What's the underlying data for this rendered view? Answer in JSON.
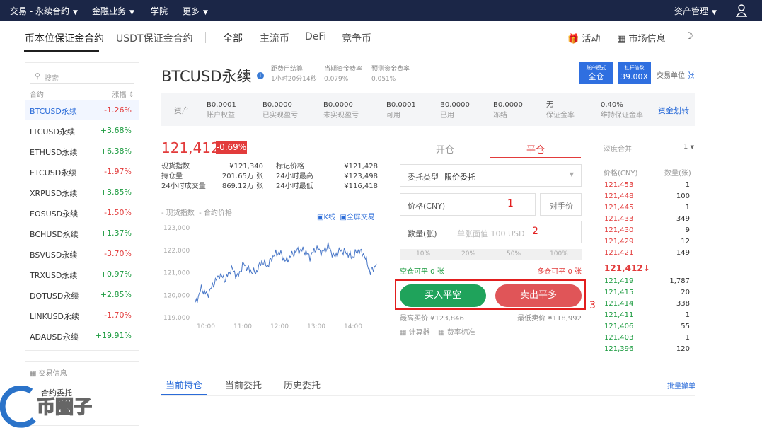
{
  "topnav": {
    "trade": "交易 - 永续合约",
    "finance": "金融业务",
    "academy": "学院",
    "more": "更多",
    "assets": "资产管理"
  },
  "subnav": {
    "coin_margined": "币本位保证金合约",
    "usdt_margined": "USDT保证金合约",
    "cat_all": "全部",
    "cat_main": "主流币",
    "cat_defi": "DeFi",
    "cat_compete": "竞争币",
    "activity": "活动",
    "market_info": "市场信息"
  },
  "sidebar": {
    "search_placeholder": "搜索",
    "col_contract": "合约",
    "col_change": "涨幅",
    "items": [
      {
        "name": "BTCUSD永续",
        "change": "-1.26%",
        "dir": "down"
      },
      {
        "name": "LTCUSD永续",
        "change": "+3.68%",
        "dir": "up"
      },
      {
        "name": "ETHUSD永续",
        "change": "+6.38%",
        "dir": "up"
      },
      {
        "name": "ETCUSD永续",
        "change": "-1.97%",
        "dir": "down"
      },
      {
        "name": "XRPUSD永续",
        "change": "+3.85%",
        "dir": "up"
      },
      {
        "name": "EOSUSD永续",
        "change": "-1.50%",
        "dir": "down"
      },
      {
        "name": "BCHUSD永续",
        "change": "+1.37%",
        "dir": "up"
      },
      {
        "name": "BSVUSD永续",
        "change": "-3.70%",
        "dir": "down"
      },
      {
        "name": "TRXUSD永续",
        "change": "+0.97%",
        "dir": "up"
      },
      {
        "name": "DOTUSD永续",
        "change": "+2.85%",
        "dir": "up"
      },
      {
        "name": "LINKUSD永续",
        "change": "-1.70%",
        "dir": "down"
      },
      {
        "name": "ADAUSD永续",
        "change": "+19.91%",
        "dir": "up"
      }
    ],
    "info_title": "交易信息",
    "info_item": "合约委托"
  },
  "header": {
    "title": "BTCUSD永续",
    "funding_label": "距费用结算",
    "funding_value": "1小时20分14秒",
    "cur_rate_label": "当期资金费率",
    "cur_rate_value": "0.079%",
    "pred_rate_label": "预测资金费率",
    "pred_rate_value": "0.051%",
    "mode_label": "账户模式",
    "mode_value": "全仓",
    "leverage_label": "杠杆倍数",
    "leverage_value": "39.00X",
    "unit_label": "交易单位",
    "unit_value": "张"
  },
  "assets": {
    "label": "资产",
    "items": [
      {
        "value": "B0.0001",
        "label": "账户权益"
      },
      {
        "value": "B0.0000",
        "label": "已实现盈亏"
      },
      {
        "value": "B0.0000",
        "label": "未实现盈亏"
      },
      {
        "value": "B0.0001",
        "label": "可用"
      },
      {
        "value": "B0.0000",
        "label": "已用"
      },
      {
        "value": "B0.0000",
        "label": "冻结"
      },
      {
        "value": "无",
        "label": "保证金率"
      },
      {
        "value": "0.40%",
        "label": "维持保证金率"
      }
    ],
    "transfer": "资金划转"
  },
  "ticker": {
    "price": "121,412",
    "change": "-0.69%",
    "index_label": "现货指数",
    "index_value": "¥121,340",
    "mark_label": "标记价格",
    "mark_value": "¥121,428",
    "oi_label": "持仓量",
    "oi_value": "201.65万 张",
    "high_label": "24小时最高",
    "high_value": "¥123,498",
    "vol_label": "24小时成交量",
    "vol_value": "869.12万 张",
    "low_label": "24小时最低",
    "low_value": "¥116,418"
  },
  "chart": {
    "legend_spot": "现货指数",
    "legend_contract": "合约价格",
    "kline": "K线",
    "fullscreen": "全屏交易"
  },
  "chart_data": {
    "type": "line",
    "title": "",
    "xlabel": "",
    "ylabel": "",
    "x_ticks": [
      "10:00",
      "11:00",
      "12:00",
      "13:00",
      "14:00"
    ],
    "y_ticks": [
      "123,000",
      "122,000",
      "121,000",
      "120,000",
      "119,000"
    ],
    "ylim": [
      119000,
      123000
    ],
    "grid": false,
    "series": [
      {
        "name": "现货指数",
        "color": "#4a78c8",
        "x": [
          0,
          0.15,
          0.3,
          0.45,
          0.6,
          0.75,
          0.9,
          1.05,
          1.2,
          1.35,
          1.5,
          1.65,
          1.8,
          1.95,
          2.1,
          2.25,
          2.4,
          2.55,
          2.7,
          2.85,
          3.0,
          3.15,
          3.3,
          3.45,
          3.6,
          3.75,
          3.9,
          4.05,
          4.2,
          4.35,
          4.5
        ],
        "values": [
          119600,
          120300,
          120000,
          120500,
          120900,
          120700,
          121200,
          120800,
          121400,
          121100,
          121000,
          121500,
          121300,
          121800,
          121900,
          121500,
          121800,
          122000,
          122000,
          121700,
          122100,
          121900,
          122200,
          121700,
          122000,
          121900,
          121700,
          122000,
          121800,
          121000,
          121400
        ]
      }
    ]
  },
  "trade": {
    "tab_open": "开仓",
    "tab_close": "平仓",
    "order_type_label": "委托类型",
    "order_type_value": "限价委托",
    "price_label": "价格(CNY)",
    "counterparty": "对手价",
    "qty_label": "数量(张)",
    "qty_placeholder": "单张面值 100 USD",
    "pct": [
      "10%",
      "20%",
      "50%",
      "100%"
    ],
    "short_closable": "空仓可平 0 张",
    "long_closable": "多仓可平 0 张",
    "buy_close": "买入平空",
    "sell_close": "卖出平多",
    "max_buy": "最高买价 ¥123,846",
    "min_sell": "最低卖价 ¥118,992",
    "calculator": "计算器",
    "fee": "费率标准",
    "annotation_1": "1",
    "annotation_2": "2",
    "annotation_3": "3"
  },
  "orderbook": {
    "merge_label": "深度合并",
    "merge_value": "1",
    "col_price": "价格(CNY)",
    "col_qty": "数量(张)",
    "asks": [
      {
        "p": "121,453",
        "q": "1"
      },
      {
        "p": "121,448",
        "q": "100"
      },
      {
        "p": "121,445",
        "q": "1"
      },
      {
        "p": "121,433",
        "q": "349"
      },
      {
        "p": "121,430",
        "q": "9"
      },
      {
        "p": "121,429",
        "q": "12"
      },
      {
        "p": "121,421",
        "q": "149"
      }
    ],
    "last": "121,412",
    "bids": [
      {
        "p": "121,419",
        "q": "1,787"
      },
      {
        "p": "121,415",
        "q": "20"
      },
      {
        "p": "121,414",
        "q": "338"
      },
      {
        "p": "121,411",
        "q": "1"
      },
      {
        "p": "121,406",
        "q": "55"
      },
      {
        "p": "121,403",
        "q": "1"
      },
      {
        "p": "121,396",
        "q": "120"
      }
    ]
  },
  "bottom": {
    "current_position": "当前持仓",
    "current_orders": "当前委托",
    "history_orders": "历史委托",
    "batch_cancel": "批量撤单"
  },
  "watermark": "币圈子"
}
